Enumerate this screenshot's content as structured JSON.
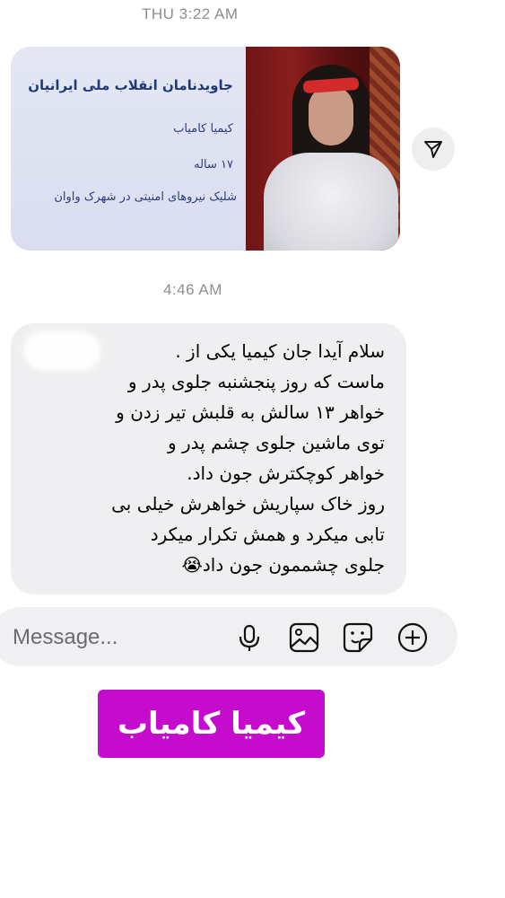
{
  "timestamps": [
    "THU 3:22 AM",
    "4:46 AM"
  ],
  "shared_card": {
    "title": "جاویدنامان انقلاب ملی ایرانیان",
    "name": "کیمیا کامیاب",
    "age": "۱۷ ساله",
    "description": "شلیک نیروهای امنیتی در شهرک واوان"
  },
  "message": {
    "text": "سلام آیدا جان کیمیا یکی از .\nماست که روز پنجشنبه جلوی پدر و\nخواهر ۱۳ سالش به قلبش تیر زدن و\nتوی ماشین جلوی چشم پدر و\nخواهر کوچکترش جون داد.\nروز خاک سپاریش خواهرش خیلی بی\nتابی میکرد و همش تکرار میکرد\nجلوی چشممون جون داد😭"
  },
  "composer": {
    "placeholder": "Message..."
  },
  "icons": [
    "share-icon",
    "microphone-icon",
    "gallery-icon",
    "sticker-icon",
    "plus-icon"
  ],
  "banner": {
    "text": "کیمیا کامیاب",
    "color": "#c50ccd"
  }
}
